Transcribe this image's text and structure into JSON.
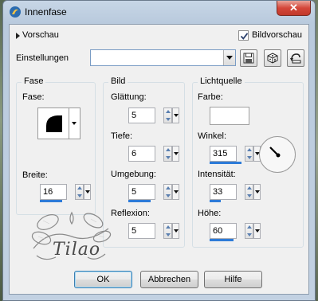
{
  "window": {
    "title": "Innenfase",
    "close_label": "✕"
  },
  "preview": {
    "label": "Vorschau",
    "bild_label": "Bildvorschau",
    "bild_checked": true
  },
  "settings": {
    "label": "Einstellungen",
    "value": ""
  },
  "fase": {
    "group_title": "Fase",
    "shape_label": "Fase:",
    "width_label": "Breite:",
    "width_value": "16"
  },
  "bild": {
    "group_title": "Bild",
    "smooth_label": "Glättung:",
    "smooth_value": "5",
    "depth_label": "Tiefe:",
    "depth_value": "6",
    "ambient_label": "Umgebung:",
    "ambient_value": "5",
    "reflect_label": "Reflexion:",
    "reflect_value": "5"
  },
  "light": {
    "group_title": "Lichtquelle",
    "color_label": "Farbe:",
    "color_value": "#ffffff",
    "angle_label": "Winkel:",
    "angle_value": "315",
    "intensity_label": "Intensität:",
    "intensity_value": "33",
    "height_label": "Höhe:",
    "height_value": "60"
  },
  "buttons": {
    "ok": "OK",
    "cancel": "Abbrechen",
    "help": "Hilfe"
  },
  "watermark": {
    "text": "Tilao"
  }
}
